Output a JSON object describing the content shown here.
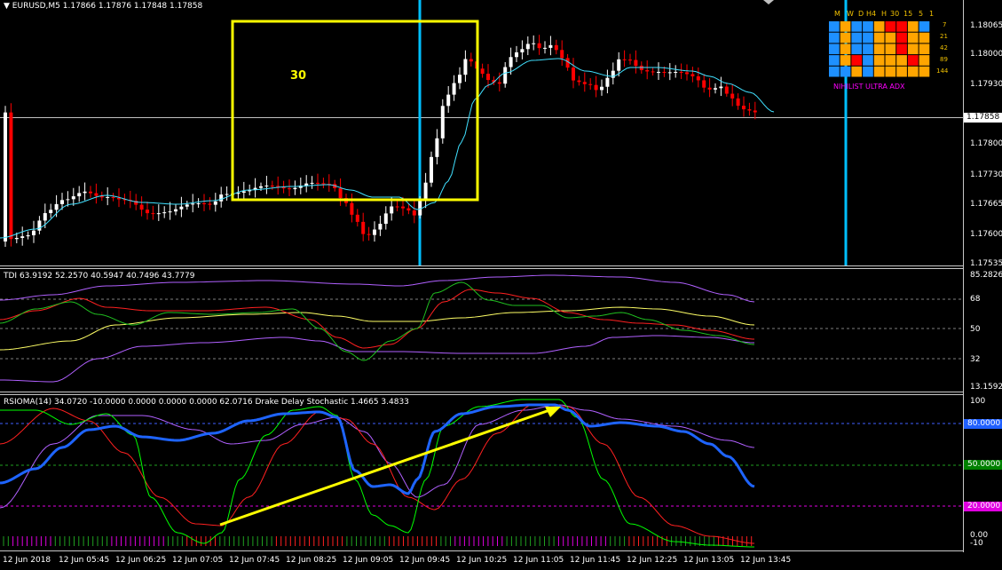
{
  "symbol_header": "EURUSD,M5  1.17866 1.17876 1.17848 1.17858",
  "box_label": "30",
  "price_axis": [
    "1.18065",
    "1.18000",
    "1.17930",
    "1.17800",
    "1.17730",
    "1.17665",
    "1.17600",
    "1.17535"
  ],
  "current_price": "1.17858",
  "tdi": {
    "header": "TDI 63.9192 52.2570 40.5947 40.7496 43.7779",
    "axis": [
      "85.2826",
      "68",
      "50",
      "32",
      "13.1592"
    ]
  },
  "rsioma": {
    "header": "RSIOMA(14) 34.0720 -10.0000 0.0000 0.0000 0.0000 62.0716  Drake Delay Stochastic 1.4665 3.4833",
    "axis_top": "100",
    "level_80": "80.0000",
    "level_50": "50.0000",
    "level_20": "20.0000",
    "axis_bottom_1": "0.00",
    "axis_bottom_2": "-10"
  },
  "time_axis": [
    "12 Jun 2018",
    "12 Jun 05:45",
    "12 Jun 06:25",
    "12 Jun 07:05",
    "12 Jun 07:45",
    "12 Jun 08:25",
    "12 Jun 09:05",
    "12 Jun 09:45",
    "12 Jun 10:25",
    "12 Jun 11:05",
    "12 Jun 11:45",
    "12 Jun 12:25",
    "12 Jun 13:05",
    "12 Jun 13:45"
  ],
  "dashboard": {
    "timeframes": [
      "M",
      "W",
      "D",
      "H4",
      "H",
      "30",
      "15",
      "5",
      "1"
    ],
    "periods": [
      "7",
      "21",
      "42",
      "89",
      "144"
    ],
    "title": "NIHILIST ULTRA ADX",
    "colors": {
      "blue": "#1e90ff",
      "orange": "#ffa500",
      "red": "#ff0000",
      "green": "#00c000"
    }
  },
  "colors": {
    "bull_candle": "#ffffff",
    "bear_candle": "#ff0000",
    "ma": "#40e0ff",
    "marker_line": "#00bfff",
    "box": "#ffff00",
    "rsioma_line": "#1e64ff",
    "stoch_green": "#00ff00",
    "stoch_red": "#ff2020",
    "ma_violet": "#b060ff",
    "arrow": "#ffff00"
  }
}
